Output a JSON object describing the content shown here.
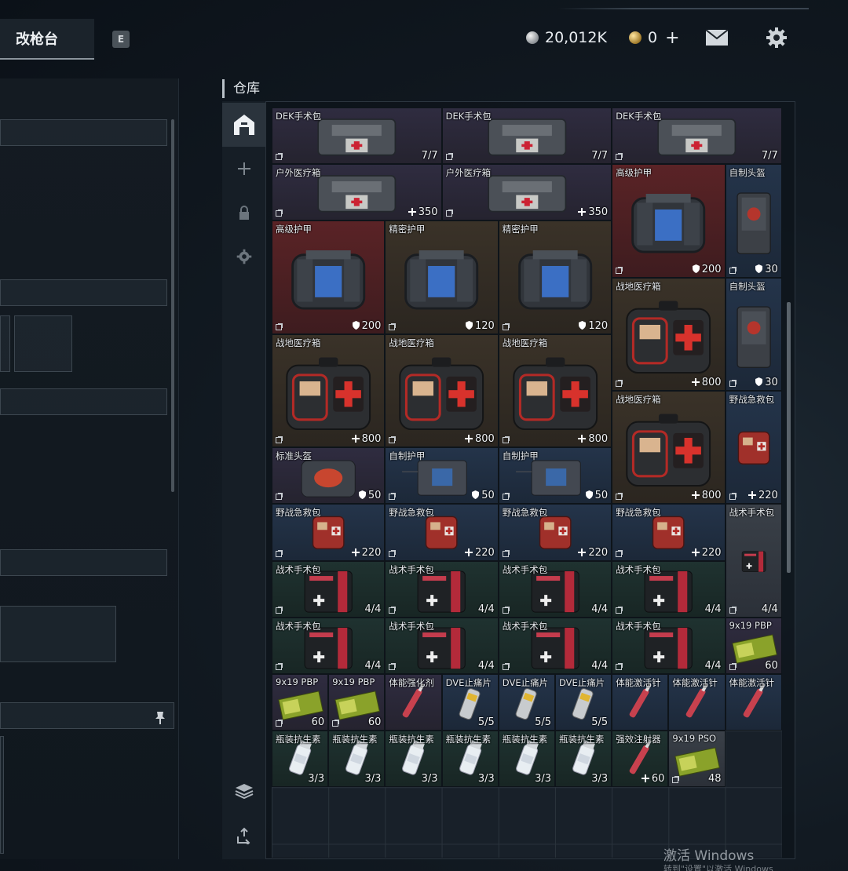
{
  "top_bar": {
    "active_tab": "改枪台",
    "key_hint": "E",
    "silver_amount": "20,012K",
    "gold_amount": "0",
    "icons": [
      "mail-icon",
      "gear-icon"
    ]
  },
  "warehouse": {
    "title": "仓库",
    "side_tabs": [
      {
        "name": "warehouse-home-icon",
        "active": true
      },
      {
        "name": "plus-icon",
        "active": false
      },
      {
        "name": "lock-icon",
        "active": false
      },
      {
        "name": "gear-icon",
        "active": false
      },
      {
        "name": "layers-icon",
        "active": false
      },
      {
        "name": "sort-icon",
        "active": false
      }
    ],
    "items": [
      {
        "name": "DEK手术包",
        "value": "7/7",
        "rarity": "purple",
        "art": "case",
        "c": 0,
        "r": 0,
        "w": 3,
        "h": 1
      },
      {
        "name": "DEK手术包",
        "value": "7/7",
        "rarity": "purple",
        "art": "case",
        "c": 3,
        "r": 0,
        "w": 3,
        "h": 1
      },
      {
        "name": "DEK手术包",
        "value": "7/7",
        "rarity": "purple",
        "art": "case",
        "c": 6,
        "r": 0,
        "w": 3,
        "h": 1
      },
      {
        "name": "户外医疗箱",
        "value": "350",
        "prefix": "plus",
        "rarity": "purple",
        "art": "case",
        "c": 0,
        "r": 1,
        "w": 3,
        "h": 1
      },
      {
        "name": "户外医疗箱",
        "value": "350",
        "prefix": "plus",
        "rarity": "purple",
        "art": "case",
        "c": 3,
        "r": 1,
        "w": 3,
        "h": 1
      },
      {
        "name": "高级护甲",
        "value": "200",
        "prefix": "shield",
        "rarity": "red",
        "art": "armor",
        "c": 6,
        "r": 1,
        "w": 2,
        "h": 2
      },
      {
        "name": "自制头盔",
        "value": "30",
        "prefix": "shield",
        "rarity": "blue",
        "art": "vest",
        "c": 8,
        "r": 1,
        "w": 1,
        "h": 2
      },
      {
        "name": "高级护甲",
        "value": "200",
        "prefix": "shield",
        "rarity": "red",
        "art": "armor",
        "c": 0,
        "r": 2,
        "w": 2,
        "h": 2
      },
      {
        "name": "精密护甲",
        "value": "120",
        "prefix": "shield",
        "rarity": "brown",
        "art": "armor",
        "c": 2,
        "r": 2,
        "w": 2,
        "h": 2
      },
      {
        "name": "精密护甲",
        "value": "120",
        "prefix": "shield",
        "rarity": "brown",
        "art": "armor",
        "c": 4,
        "r": 2,
        "w": 2,
        "h": 2
      },
      {
        "name": "战地医疗箱",
        "value": "800",
        "prefix": "plus",
        "rarity": "brown",
        "art": "medkit",
        "c": 6,
        "r": 3,
        "w": 2,
        "h": 2
      },
      {
        "name": "自制头盔",
        "value": "30",
        "prefix": "shield",
        "rarity": "blue",
        "art": "vest",
        "c": 8,
        "r": 3,
        "w": 1,
        "h": 2
      },
      {
        "name": "战地医疗箱",
        "value": "800",
        "prefix": "plus",
        "rarity": "brown",
        "art": "medkit",
        "c": 0,
        "r": 4,
        "w": 2,
        "h": 2
      },
      {
        "name": "战地医疗箱",
        "value": "800",
        "prefix": "plus",
        "rarity": "brown",
        "art": "medkit",
        "c": 2,
        "r": 4,
        "w": 2,
        "h": 2
      },
      {
        "name": "战地医疗箱",
        "value": "800",
        "prefix": "plus",
        "rarity": "brown",
        "art": "medkit",
        "c": 4,
        "r": 4,
        "w": 2,
        "h": 2
      },
      {
        "name": "战地医疗箱",
        "value": "800",
        "prefix": "plus",
        "rarity": "brown",
        "art": "medkit",
        "c": 6,
        "r": 5,
        "w": 2,
        "h": 2
      },
      {
        "name": "野战急救包",
        "value": "220",
        "prefix": "plus",
        "rarity": "blue",
        "art": "redbox",
        "c": 8,
        "r": 5,
        "w": 1,
        "h": 2
      },
      {
        "name": "标准头盔",
        "value": "50",
        "prefix": "shield",
        "rarity": "purple",
        "art": "helmetbag",
        "c": 0,
        "r": 6,
        "w": 2,
        "h": 1
      },
      {
        "name": "自制护甲",
        "value": "50",
        "prefix": "shield",
        "rarity": "blue",
        "art": "vestflat",
        "c": 2,
        "r": 6,
        "w": 2,
        "h": 1
      },
      {
        "name": "自制护甲",
        "value": "50",
        "prefix": "shield",
        "rarity": "blue",
        "art": "vestflat",
        "c": 4,
        "r": 6,
        "w": 2,
        "h": 1
      },
      {
        "name": "野战急救包",
        "value": "220",
        "prefix": "plus",
        "rarity": "blue",
        "art": "redbox",
        "c": 0,
        "r": 7,
        "w": 2,
        "h": 1
      },
      {
        "name": "野战急救包",
        "value": "220",
        "prefix": "plus",
        "rarity": "blue",
        "art": "redbox",
        "c": 2,
        "r": 7,
        "w": 2,
        "h": 1
      },
      {
        "name": "野战急救包",
        "value": "220",
        "prefix": "plus",
        "rarity": "blue",
        "art": "redbox",
        "c": 4,
        "r": 7,
        "w": 2,
        "h": 1
      },
      {
        "name": "野战急救包",
        "value": "220",
        "prefix": "plus",
        "rarity": "blue",
        "art": "redbox",
        "c": 6,
        "r": 7,
        "w": 2,
        "h": 1
      },
      {
        "name": "战术手术包",
        "value": "4/4",
        "rarity": "gray",
        "art": "pouch",
        "c": 8,
        "r": 7,
        "w": 1,
        "h": 2
      },
      {
        "name": "战术手术包",
        "value": "4/4",
        "rarity": "green",
        "art": "pouch",
        "c": 0,
        "r": 8,
        "w": 2,
        "h": 1
      },
      {
        "name": "战术手术包",
        "value": "4/4",
        "rarity": "green",
        "art": "pouch",
        "c": 2,
        "r": 8,
        "w": 2,
        "h": 1
      },
      {
        "name": "战术手术包",
        "value": "4/4",
        "rarity": "green",
        "art": "pouch",
        "c": 4,
        "r": 8,
        "w": 2,
        "h": 1
      },
      {
        "name": "战术手术包",
        "value": "4/4",
        "rarity": "green",
        "art": "pouch",
        "c": 6,
        "r": 8,
        "w": 2,
        "h": 1
      },
      {
        "name": "战术手术包",
        "value": "4/4",
        "rarity": "green",
        "art": "pouch",
        "c": 0,
        "r": 9,
        "w": 2,
        "h": 1
      },
      {
        "name": "战术手术包",
        "value": "4/4",
        "rarity": "green",
        "art": "pouch",
        "c": 2,
        "r": 9,
        "w": 2,
        "h": 1
      },
      {
        "name": "战术手术包",
        "value": "4/4",
        "rarity": "green",
        "art": "pouch",
        "c": 4,
        "r": 9,
        "w": 2,
        "h": 1
      },
      {
        "name": "战术手术包",
        "value": "4/4",
        "rarity": "green",
        "art": "pouch",
        "c": 6,
        "r": 9,
        "w": 2,
        "h": 1
      },
      {
        "name": "9x19 PBP",
        "value": "60",
        "rarity": "purple",
        "art": "ammo",
        "c": 8,
        "r": 9,
        "w": 1,
        "h": 1
      },
      {
        "name": "9x19 PBP",
        "value": "60",
        "rarity": "purple",
        "art": "ammo",
        "c": 0,
        "r": 10,
        "w": 1,
        "h": 1
      },
      {
        "name": "9x19 PBP",
        "value": "60",
        "rarity": "purple",
        "art": "ammo",
        "c": 1,
        "r": 10,
        "w": 1,
        "h": 1
      },
      {
        "name": "体能强化剂",
        "value": "",
        "rarity": "purple",
        "art": "syringe",
        "c": 2,
        "r": 10,
        "w": 1,
        "h": 1
      },
      {
        "name": "DVE止痛片",
        "value": "5/5",
        "rarity": "blue",
        "art": "pills",
        "c": 3,
        "r": 10,
        "w": 1,
        "h": 1
      },
      {
        "name": "DVE止痛片",
        "value": "5/5",
        "rarity": "blue",
        "art": "pills",
        "c": 4,
        "r": 10,
        "w": 1,
        "h": 1
      },
      {
        "name": "DVE止痛片",
        "value": "5/5",
        "rarity": "blue",
        "art": "pills",
        "c": 5,
        "r": 10,
        "w": 1,
        "h": 1
      },
      {
        "name": "体能激活针",
        "value": "",
        "rarity": "blue",
        "art": "syringe",
        "c": 6,
        "r": 10,
        "w": 1,
        "h": 1
      },
      {
        "name": "体能激活针",
        "value": "",
        "rarity": "blue",
        "art": "syringe",
        "c": 7,
        "r": 10,
        "w": 1,
        "h": 1
      },
      {
        "name": "体能激活针",
        "value": "",
        "rarity": "blue",
        "art": "syringe",
        "c": 8,
        "r": 10,
        "w": 1,
        "h": 1
      },
      {
        "name": "瓶装抗生素",
        "value": "3/3",
        "rarity": "green",
        "art": "bottle",
        "c": 0,
        "r": 11,
        "w": 1,
        "h": 1
      },
      {
        "name": "瓶装抗生素",
        "value": "3/3",
        "rarity": "green",
        "art": "bottle",
        "c": 1,
        "r": 11,
        "w": 1,
        "h": 1
      },
      {
        "name": "瓶装抗生素",
        "value": "3/3",
        "rarity": "green",
        "art": "bottle",
        "c": 2,
        "r": 11,
        "w": 1,
        "h": 1
      },
      {
        "name": "瓶装抗生素",
        "value": "3/3",
        "rarity": "green",
        "art": "bottle",
        "c": 3,
        "r": 11,
        "w": 1,
        "h": 1
      },
      {
        "name": "瓶装抗生素",
        "value": "3/3",
        "rarity": "green",
        "art": "bottle",
        "c": 4,
        "r": 11,
        "w": 1,
        "h": 1
      },
      {
        "name": "瓶装抗生素",
        "value": "3/3",
        "rarity": "green",
        "art": "bottle",
        "c": 5,
        "r": 11,
        "w": 1,
        "h": 1
      },
      {
        "name": "强效注射器",
        "value": "60",
        "prefix": "plus",
        "rarity": "green",
        "art": "syringe",
        "c": 6,
        "r": 11,
        "w": 1,
        "h": 1
      },
      {
        "name": "9x19 PSO",
        "value": "48",
        "rarity": "gray",
        "art": "ammo",
        "c": 7,
        "r": 11,
        "w": 1,
        "h": 1
      }
    ]
  },
  "watermark": {
    "line1": "激活 Windows",
    "line2": "转到\"设置\"以激活 Windows"
  }
}
